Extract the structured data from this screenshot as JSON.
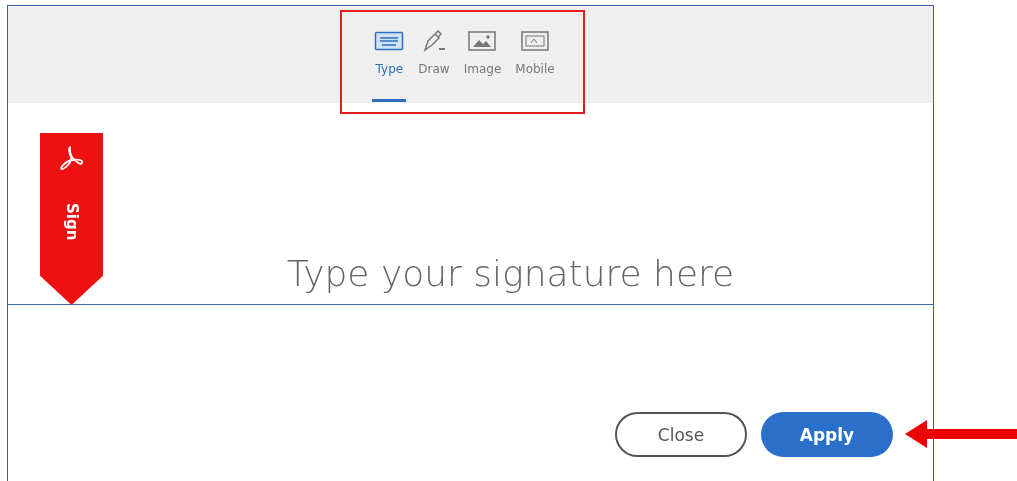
{
  "tabs": [
    {
      "label": "Type",
      "kind": "keyboard",
      "selected": true
    },
    {
      "label": "Draw",
      "kind": "pen",
      "selected": false
    },
    {
      "label": "Image",
      "kind": "image",
      "selected": false
    },
    {
      "label": "Mobile",
      "kind": "mobile",
      "selected": false
    }
  ],
  "banner": {
    "label": "Sign"
  },
  "signature": {
    "placeholder": "Type your signature here"
  },
  "buttons": [
    {
      "label": "Close",
      "kind": "secondary"
    },
    {
      "label": "Apply",
      "kind": "primary"
    }
  ]
}
